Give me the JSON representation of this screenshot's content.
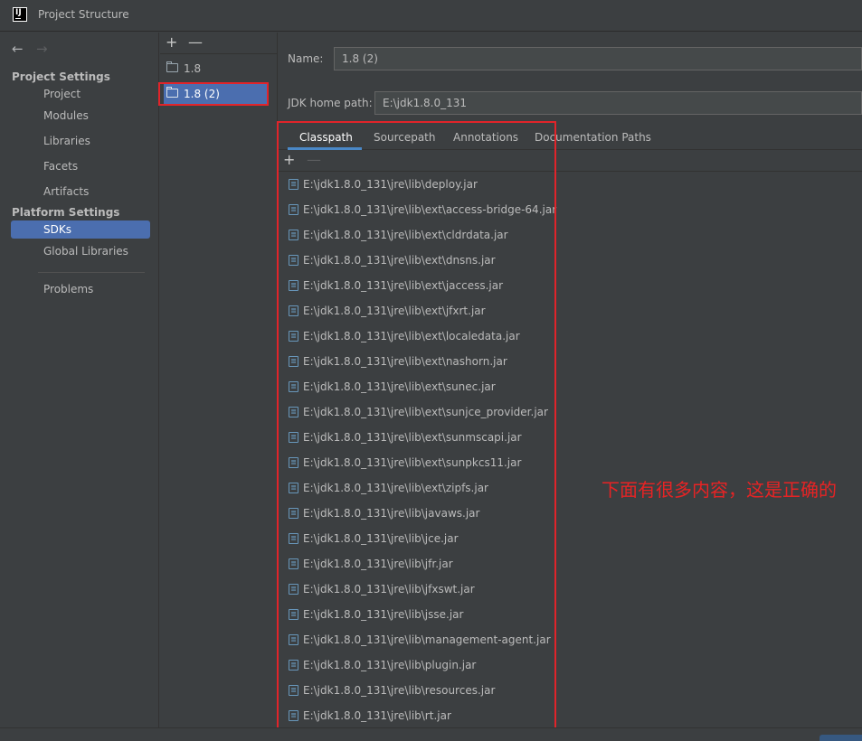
{
  "window": {
    "title": "Project Structure",
    "logo_text": "IJ"
  },
  "nav": {
    "back": "←",
    "forward": "→",
    "project_settings_header": "Project Settings",
    "project_items": [
      "Project",
      "Modules",
      "Libraries",
      "Facets",
      "Artifacts"
    ],
    "platform_settings_header": "Platform Settings",
    "platform_items": [
      "SDKs",
      "Global Libraries"
    ],
    "selected": "SDKs",
    "problems": "Problems"
  },
  "sdk_list": {
    "add": "+",
    "remove": "—",
    "items": [
      "1.8",
      "1.8 (2)"
    ],
    "selected": "1.8 (2)"
  },
  "detail": {
    "name_label": "Name:",
    "name_value": "1.8 (2)",
    "jdk_home_label": "JDK home path:",
    "jdk_home_value": "E:\\jdk1.8.0_131",
    "tabs": [
      "Classpath",
      "Sourcepath",
      "Annotations",
      "Documentation Paths"
    ],
    "active_tab": "Classpath",
    "add": "+",
    "remove": "—",
    "classpath": [
      "E:\\jdk1.8.0_131\\jre\\lib\\deploy.jar",
      "E:\\jdk1.8.0_131\\jre\\lib\\ext\\access-bridge-64.jar",
      "E:\\jdk1.8.0_131\\jre\\lib\\ext\\cldrdata.jar",
      "E:\\jdk1.8.0_131\\jre\\lib\\ext\\dnsns.jar",
      "E:\\jdk1.8.0_131\\jre\\lib\\ext\\jaccess.jar",
      "E:\\jdk1.8.0_131\\jre\\lib\\ext\\jfxrt.jar",
      "E:\\jdk1.8.0_131\\jre\\lib\\ext\\localedata.jar",
      "E:\\jdk1.8.0_131\\jre\\lib\\ext\\nashorn.jar",
      "E:\\jdk1.8.0_131\\jre\\lib\\ext\\sunec.jar",
      "E:\\jdk1.8.0_131\\jre\\lib\\ext\\sunjce_provider.jar",
      "E:\\jdk1.8.0_131\\jre\\lib\\ext\\sunmscapi.jar",
      "E:\\jdk1.8.0_131\\jre\\lib\\ext\\sunpkcs11.jar",
      "E:\\jdk1.8.0_131\\jre\\lib\\ext\\zipfs.jar",
      "E:\\jdk1.8.0_131\\jre\\lib\\javaws.jar",
      "E:\\jdk1.8.0_131\\jre\\lib\\jce.jar",
      "E:\\jdk1.8.0_131\\jre\\lib\\jfr.jar",
      "E:\\jdk1.8.0_131\\jre\\lib\\jfxswt.jar",
      "E:\\jdk1.8.0_131\\jre\\lib\\jsse.jar",
      "E:\\jdk1.8.0_131\\jre\\lib\\management-agent.jar",
      "E:\\jdk1.8.0_131\\jre\\lib\\plugin.jar",
      "E:\\jdk1.8.0_131\\jre\\lib\\resources.jar",
      "E:\\jdk1.8.0_131\\jre\\lib\\rt.jar"
    ]
  },
  "annotation": "下面有很多内容，这是正确的",
  "colors": {
    "background": "#3c3f41",
    "selection": "#4b6eaf",
    "highlight_box": "#e1242a",
    "annotation_text": "#e82324",
    "tab_underline": "#4a88c7"
  },
  "icons": {
    "jar": "library-jar-icon",
    "sdk": "folder-sdk-icon"
  }
}
